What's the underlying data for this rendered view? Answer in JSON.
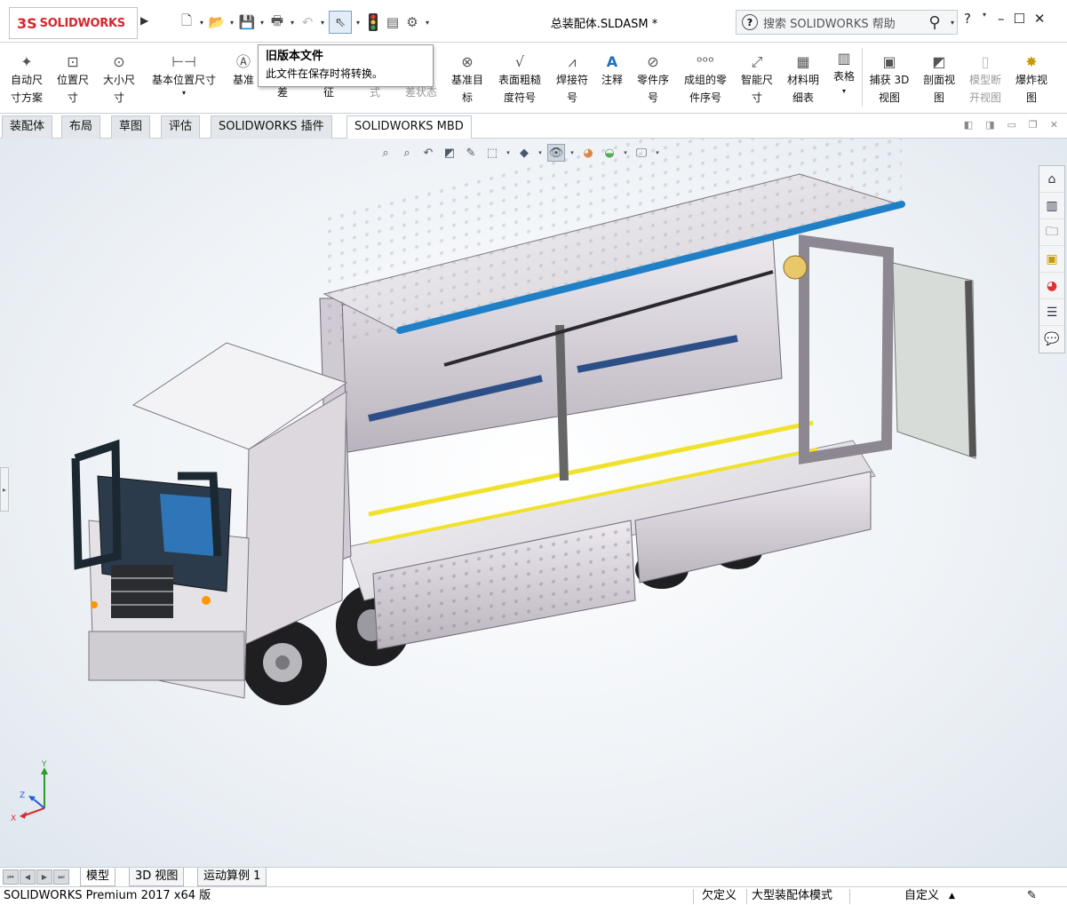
{
  "app": {
    "brand_mark": "3S",
    "brand": "SOLIDWORKS",
    "document_title": "总装配体.SLDASM *"
  },
  "search": {
    "placeholder": "搜索 SOLIDWORKS 帮助"
  },
  "window_controls": {
    "help": "?",
    "minimize": "–",
    "maximize": "☐",
    "close": "✕"
  },
  "tooltip": {
    "title": "旧版本文件",
    "body": "此文件在保存时将转换。"
  },
  "commands": [
    {
      "label": "自动尺\n寸方案",
      "icon": "auto-dimension-icon"
    },
    {
      "label": "位置尺\n寸",
      "icon": "location-dimension-icon"
    },
    {
      "label": "大小尺\n寸",
      "icon": "size-dimension-icon"
    },
    {
      "label": "基本位置尺寸",
      "icon": "basic-location-dimension-icon"
    },
    {
      "label": "基准",
      "icon": "datum-icon"
    },
    {
      "label": "差",
      "icon": "tolerance-icon"
    },
    {
      "label": "征",
      "icon": "feature-icon"
    },
    {
      "label": "式",
      "icon": "format-icon"
    },
    {
      "label": "差状态",
      "icon": "tolerance-status-icon"
    },
    {
      "label": "基准目\n标",
      "icon": "datum-target-icon"
    },
    {
      "label": "表面粗糙\n度符号",
      "icon": "surface-finish-icon"
    },
    {
      "label": "焊接符\n号",
      "icon": "weld-symbol-icon"
    },
    {
      "label": "注释",
      "icon": "note-icon"
    },
    {
      "label": "零件序\n号",
      "icon": "balloon-icon"
    },
    {
      "label": "成组的零\n件序号",
      "icon": "stacked-balloon-icon"
    },
    {
      "label": "智能尺\n寸",
      "icon": "smart-dimension-icon"
    },
    {
      "label": "材料明\n细表",
      "icon": "bom-icon"
    },
    {
      "label": "表格",
      "icon": "table-icon"
    },
    {
      "label": "捕获 3D\n视图",
      "icon": "capture-3d-view-icon"
    },
    {
      "label": "剖面视\n图",
      "icon": "section-view-icon"
    },
    {
      "label": "模型断\n开视图",
      "icon": "model-break-view-icon"
    },
    {
      "label": "爆炸视\n图",
      "icon": "exploded-view-icon"
    }
  ],
  "tabs": [
    "装配体",
    "布局",
    "草图",
    "评估",
    "SOLIDWORKS 插件",
    "SOLIDWORKS MBD"
  ],
  "active_tab": "SOLIDWORKS MBD",
  "triad": {
    "x": "X",
    "y": "Y",
    "z": "Z"
  },
  "bottom_tabs": [
    "模型",
    "3D 视图",
    "运动算例 1"
  ],
  "status": {
    "product": "SOLIDWORKS Premium 2017 x64 版",
    "definition": "欠定义",
    "mode": "大型装配体模式",
    "units": "自定义"
  },
  "colors": {
    "accent": "#d8262d",
    "stripe_blue": "#1f80c8",
    "stripe_yellow": "#f0e22c"
  }
}
